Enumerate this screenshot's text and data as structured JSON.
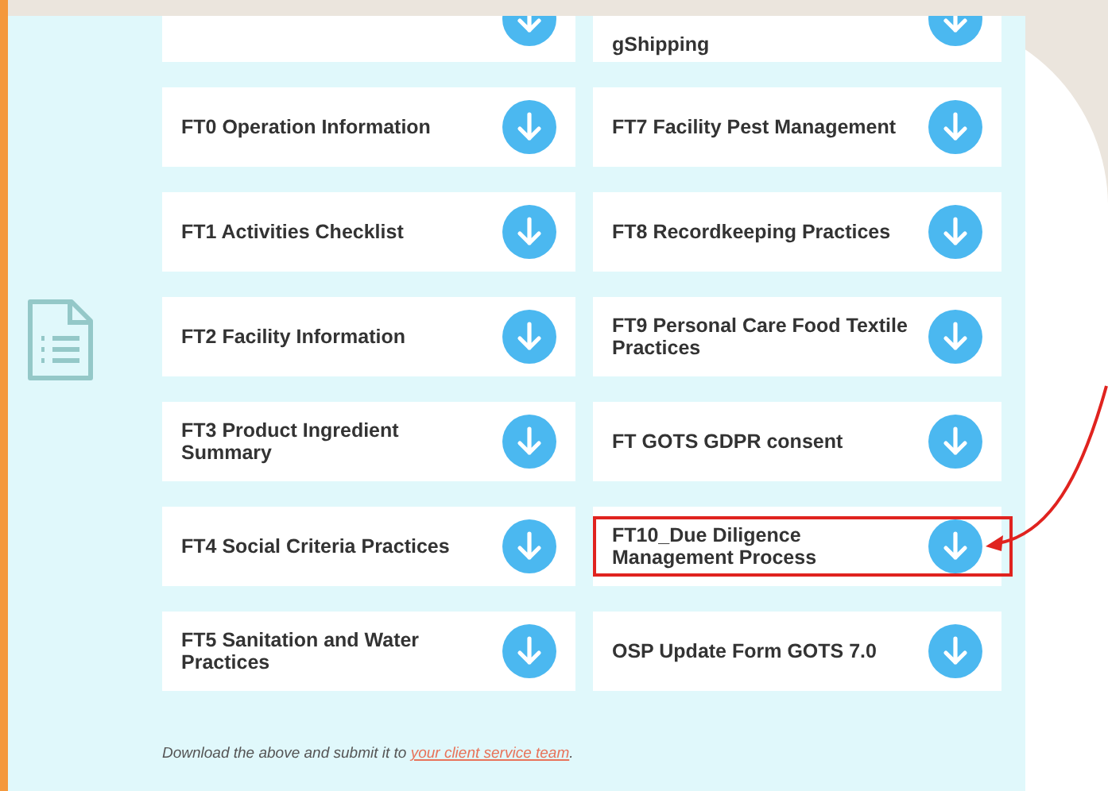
{
  "partial_row": {
    "right_label": "gShipping"
  },
  "cards": [
    {
      "label": "FT0 Operation Information",
      "highlighted": false
    },
    {
      "label": "FT7 Facility Pest Management",
      "highlighted": false
    },
    {
      "label": "FT1 Activities Checklist",
      "highlighted": false
    },
    {
      "label": "FT8 Recordkeeping Practices",
      "highlighted": false
    },
    {
      "label": "FT2 Facility Information",
      "highlighted": false
    },
    {
      "label": "FT9 Personal Care Food Textile Practices",
      "highlighted": false
    },
    {
      "label": "FT3 Product Ingredient Summary",
      "highlighted": false
    },
    {
      "label": "FT GOTS GDPR consent",
      "highlighted": false
    },
    {
      "label": "FT4 Social Criteria Practices",
      "highlighted": false
    },
    {
      "label": "FT10_Due Diligence Management Process",
      "highlighted": true
    },
    {
      "label": "FT5 Sanitation and Water Practices",
      "highlighted": false
    },
    {
      "label": "OSP Update Form GOTS 7.0",
      "highlighted": false
    }
  ],
  "footer": {
    "text": "Download the above and submit it to ",
    "link": "your client service team",
    "end": "."
  }
}
